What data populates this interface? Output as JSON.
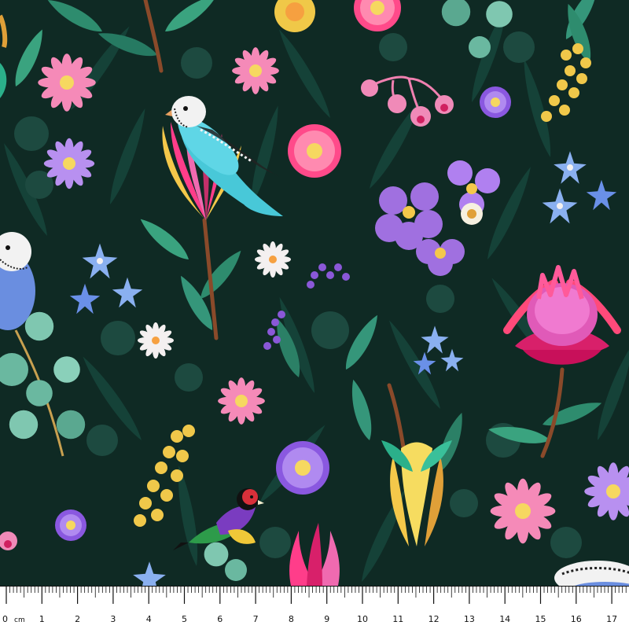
{
  "fabric": {
    "background_color": "#0f2a24",
    "motifs": [
      "budgerigar",
      "gouldian-finch",
      "protea",
      "waratah",
      "wattle",
      "gum-blossom",
      "daisy",
      "star-flower",
      "eucalyptus-leaf",
      "gum-nut"
    ]
  },
  "ruler": {
    "numbers": [
      "1",
      "2",
      "3",
      "4",
      "5",
      "6",
      "7",
      "8",
      "9",
      "10",
      "11",
      "12",
      "13",
      "14",
      "15",
      "16",
      "17"
    ],
    "zero_label": "0",
    "unit_label": "cm"
  }
}
